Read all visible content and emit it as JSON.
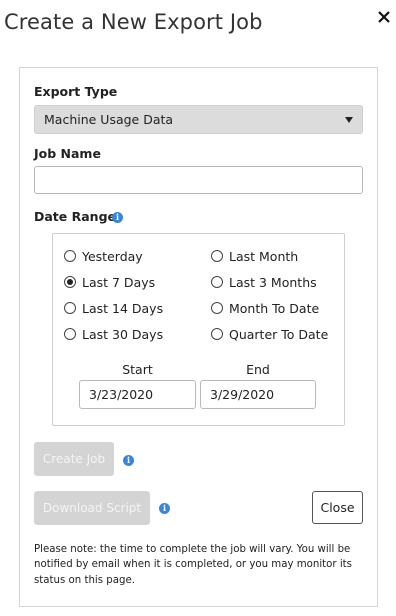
{
  "dialog": {
    "title": "Create a New Export Job"
  },
  "form": {
    "export_type": {
      "label": "Export Type",
      "selected": "Machine Usage Data"
    },
    "job_name": {
      "label": "Job Name",
      "value": ""
    },
    "date_range": {
      "label": "Date Range",
      "options": [
        {
          "label": "Yesterday",
          "checked": false
        },
        {
          "label": "Last 7 Days",
          "checked": true
        },
        {
          "label": "Last 14 Days",
          "checked": false
        },
        {
          "label": "Last 30 Days",
          "checked": false
        },
        {
          "label": "Last Month",
          "checked": false
        },
        {
          "label": "Last 3 Months",
          "checked": false
        },
        {
          "label": "Month To Date",
          "checked": false
        },
        {
          "label": "Quarter To Date",
          "checked": false
        }
      ],
      "start_label": "Start",
      "end_label": "End",
      "start_value": "3/23/2020",
      "end_value": "3/29/2020"
    }
  },
  "buttons": {
    "create_job": "Create Job",
    "download_script": "Download Script",
    "close": "Close"
  },
  "note": "Please note: the time to complete the job will vary. You will be notified by email when it is completed, or you may monitor its status on this page.",
  "colors": {
    "info_icon": "#3a86d6",
    "disabled_button": "#d4d4d4",
    "select_bg": "#dcdcdc"
  },
  "icons": {
    "close": "close-icon",
    "info": "info-icon",
    "dropdown": "chevron-down-icon"
  }
}
